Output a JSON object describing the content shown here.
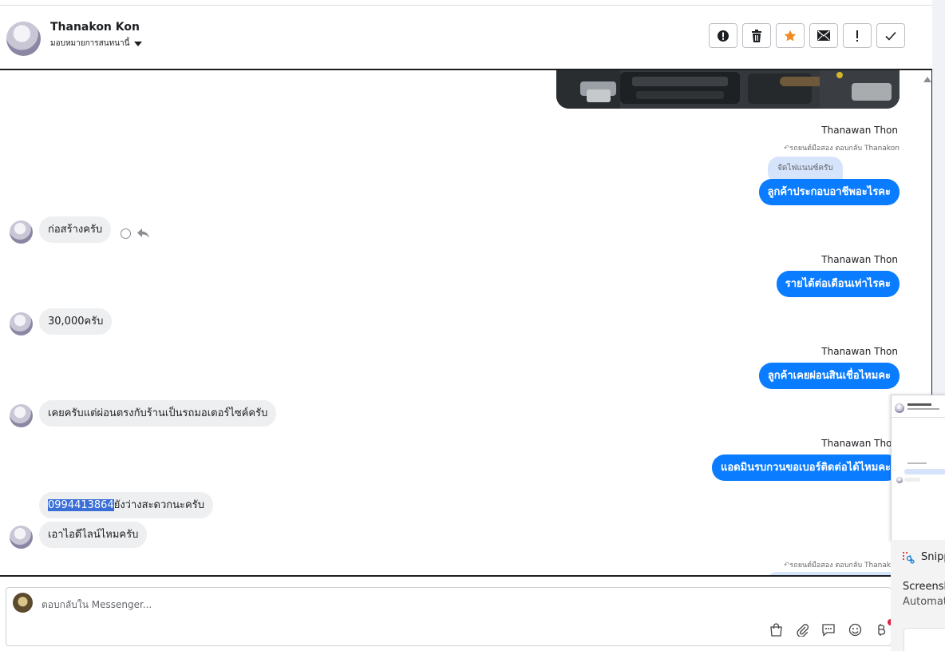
{
  "header": {
    "name": "Thanakon Kon",
    "assign_label": "มอบหมายการสนทนานี้",
    "toolbar": [
      {
        "name": "spam-report-button",
        "icon": "alert-circle-icon"
      },
      {
        "name": "delete-button",
        "icon": "trash-icon"
      },
      {
        "name": "star-button",
        "icon": "star-icon"
      },
      {
        "name": "mark-unread-button",
        "icon": "envelope-icon"
      },
      {
        "name": "follow-up-button",
        "icon": "exclamation-icon"
      },
      {
        "name": "mark-done-button",
        "icon": "check-icon"
      }
    ]
  },
  "messages": {
    "m1_sender": "Thanawan Thon",
    "m1_reply_note": "รถยนต์มือสอง ตอบกลับ Thanakon",
    "m1_quote": "จัดไฟแนนซ์ครับ",
    "m1_text": "ลูกค้าประกอบอาชีพอะไรคะ",
    "m2_text": "ก่อสร้างครับ",
    "m3_sender": "Thanawan Thon",
    "m3_text": "รายได้ต่อเดือนเท่าไรคะ",
    "m4_text": "30,000ครับ",
    "m5_sender": "Thanawan Thon",
    "m5_text": "ลูกค้าเคยผ่อนสินเชื่อไหมคะ",
    "m6_text": "เคยครับแต่ผ่อนตรงกับร้านเป็นรถมอเตอร์ไซค์ครับ",
    "m7_sender": "Thanawan Thon",
    "m7_text": "แอดมินรบกวนขอเบอร์ติดต่อได้ไหมคะ",
    "m8_highlight": "0994413864",
    "m8_rest": "ยังว่างสะดวกนะครับ",
    "m9_text": "เอาไอดีไลน์ไหมครับ",
    "m10_reply_note": "รถยนต์มือสอง ตอบกลับ Thanakon"
  },
  "composer": {
    "placeholder": "ตอบกลับใน Messenger..."
  },
  "snipping": {
    "title": "Snipp",
    "line1": "Screensh",
    "line2": "Automat"
  }
}
